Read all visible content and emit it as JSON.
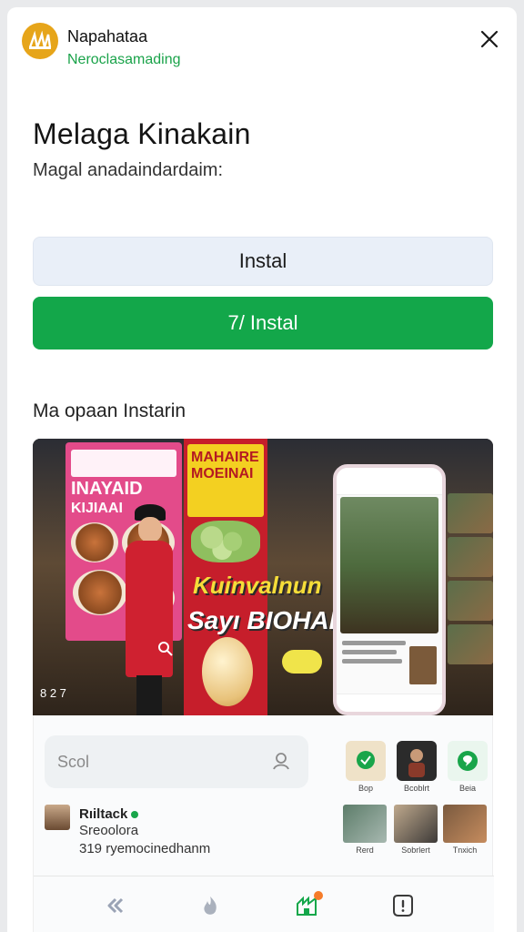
{
  "header": {
    "app_name": "Napahataa",
    "app_subtitle": "Neroclasamading",
    "logo_text": "ꟿ"
  },
  "main": {
    "title": "Melaga Kinakain",
    "description": "Magal anadaindardaim:",
    "install_button": "Instal",
    "primary_install_button": "7/ Instal",
    "preview_heading": "Ma opaan Instarin"
  },
  "screenshot": {
    "poster_left_line1": "INAYAID",
    "poster_left_line2": "KIJIAAI",
    "poster_mid_text": "MAHAIRE MOEINAI",
    "overlay_line1": "Kuinvalnun",
    "overlay_line2": "Sayı BIOHAD",
    "ticker": "8 2 7"
  },
  "panel": {
    "search_placeholder": "Scol",
    "app_tiles": [
      {
        "label": "Bop",
        "color": "#efe2c8",
        "icon": "chat-bubble-icon"
      },
      {
        "label": "Bcoblrt",
        "color": "#2b2b2b",
        "icon": "portrait-icon"
      },
      {
        "label": "Beia",
        "color": "#eaf6ee",
        "icon": "chat-bubble-icon"
      }
    ],
    "developer": {
      "name": "Rıiltack",
      "subtitle": "Sreoolora",
      "count": "319 ryemocinedhanm"
    },
    "thumbs": [
      {
        "label": "Rerd"
      },
      {
        "label": "Sobrlert"
      },
      {
        "label": "Tnxich"
      }
    ]
  },
  "bottom_nav": {
    "items": [
      "back-icon",
      "flame-icon",
      "store-icon",
      "info-icon"
    ],
    "accent_color": "#13a74a",
    "badge_color": "#f57c2a"
  },
  "colors": {
    "brand_green": "#13a74a",
    "subtitle_green": "#1aa34a",
    "light_button": "#e9eff8"
  }
}
